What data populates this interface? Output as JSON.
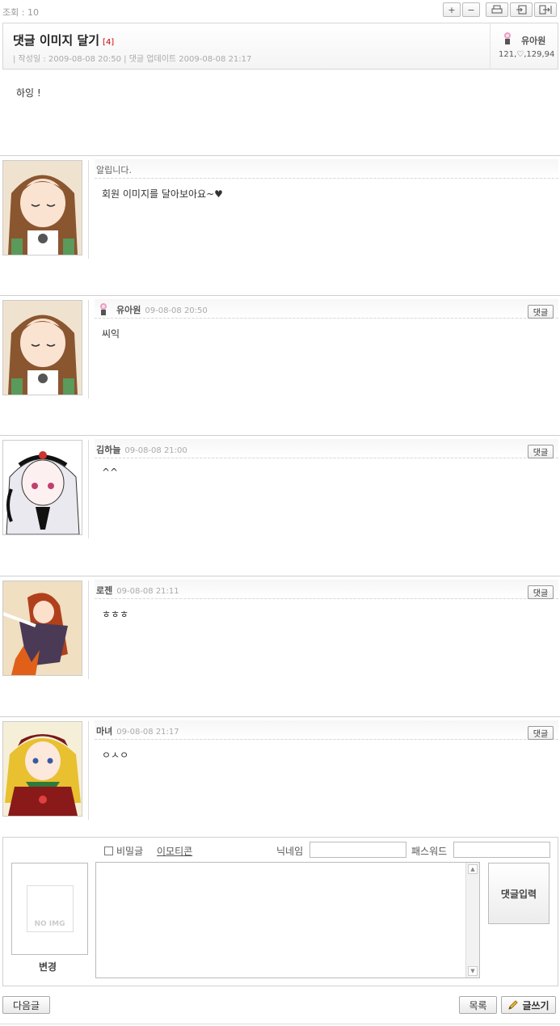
{
  "header": {
    "views": "조회 : 10",
    "toolbar": {
      "font_up": "+",
      "font_down": "−"
    }
  },
  "post": {
    "title": "댓글 이미지 달기",
    "comment_count": "[4]",
    "meta": "| 작성일 : 2009-08-08 20:50 | 댓글 업데이트 2009-08-08 21:17",
    "author": "유아원",
    "author_stats": "121,♡,129,94",
    "body": "하잉 !"
  },
  "notice": {
    "title": "알립니다.",
    "text": "회원 이미지를 달아보아요~♥"
  },
  "comments": [
    {
      "name": "유아원",
      "date": "09-08-08 20:50",
      "text": "씨익",
      "reply": "댓글"
    },
    {
      "name": "김하늘",
      "date": "09-08-08 21:00",
      "text": "^^",
      "reply": "댓글"
    },
    {
      "name": "로젠",
      "date": "09-08-08 21:11",
      "text": "ㅎㅎㅎ",
      "reply": "댓글"
    },
    {
      "name": "마녀",
      "date": "09-08-08 21:17",
      "text": "ㅇㅅㅇ",
      "reply": "댓글"
    }
  ],
  "write": {
    "noimg": "NO IMG",
    "change": "변경",
    "secret": "비밀글",
    "emoticon": "이모티콘",
    "nickname_label": "닉네임",
    "password_label": "패스워드",
    "submit": "댓글입력"
  },
  "footer": {
    "next": "다음글",
    "list": "목록",
    "write": "글쓰기"
  },
  "colors": {
    "accent_red": "#cc0000",
    "border": "#cfcfcf"
  }
}
